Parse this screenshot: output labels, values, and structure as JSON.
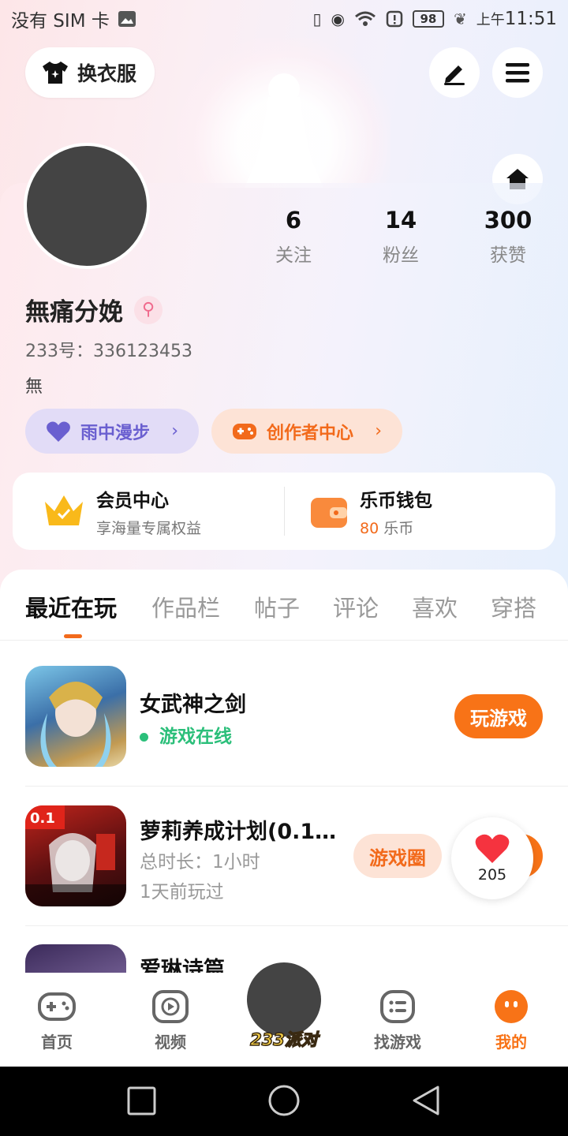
{
  "status_bar": {
    "carrier": "没有 SIM 卡",
    "battery": "98",
    "time_prefix": "上午",
    "time": "11:51"
  },
  "header": {
    "outfit_label": "换衣服"
  },
  "profile": {
    "username": "無痛分娩",
    "gender_icon": "female-icon",
    "uid": "233号：336123453",
    "bio": "無",
    "stats": [
      {
        "value": "6",
        "label": "关注"
      },
      {
        "value": "14",
        "label": "粉丝"
      },
      {
        "value": "300",
        "label": "获赞"
      }
    ],
    "pills": {
      "rain_label": "雨中漫步",
      "creator_label": "创作者中心"
    }
  },
  "member": {
    "vip_title": "会员中心",
    "vip_sub": "享海量专属权益",
    "wallet_title": "乐币钱包",
    "wallet_amount": "80",
    "wallet_unit": " 乐币"
  },
  "tabs": [
    "最近在玩",
    "作品栏",
    "帖子",
    "评论",
    "喜欢",
    "穿搭"
  ],
  "games": [
    {
      "title": "女武神之剑",
      "status": "游戏在线",
      "button": "玩游戏"
    },
    {
      "title": "萝莉养成计划(0.1…",
      "duration": "总时长：1小时",
      "last_played": "1天前玩过",
      "button": "游戏圈"
    },
    {
      "title": "爱琳诗篇"
    }
  ],
  "like_bubble": {
    "count": "205"
  },
  "bottom_nav": [
    {
      "label": "首页",
      "icon": "gamepad-icon"
    },
    {
      "label": "视频",
      "icon": "video-icon"
    },
    {
      "label": "233派对",
      "icon": "party-icon"
    },
    {
      "label": "找游戏",
      "icon": "list-icon"
    },
    {
      "label": "我的",
      "icon": "profile-icon"
    }
  ],
  "colors": {
    "accent": "#f87317",
    "online": "#2bbf7a",
    "rain_pill_text": "#6a5fd0"
  }
}
